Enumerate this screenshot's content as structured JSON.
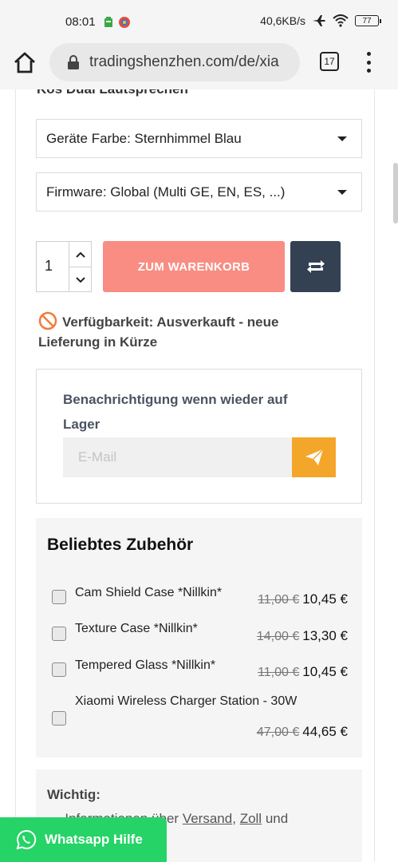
{
  "status_bar": {
    "time": "08:01",
    "speed": "40,6KB/s",
    "battery": "77",
    "icons": [
      "notification-app-icon",
      "browser-app-icon",
      "airplane-icon",
      "wifi-icon",
      "battery-icon"
    ]
  },
  "browser": {
    "url": "tradingshenzhen.com/de/xia",
    "tab_count": "17"
  },
  "product": {
    "cut_heading": "Kos Dual Lautsprechen",
    "color_select": "Geräte Farbe: Sternhimmel Blau",
    "firmware_select": "Firmware: Global (Multi GE, EN, ES, ...)",
    "quantity": "1",
    "cart_button": "ZUM WARENKORB",
    "availability": "Verfügbarkeit: Ausverkauft - neue Lieferung in Kürze"
  },
  "notify": {
    "title": "Benachrichtigung wenn wieder auf Lager",
    "email_placeholder": "E-Mail"
  },
  "accessories": {
    "title": "Beliebtes Zubehör",
    "items": [
      {
        "name": "Cam Shield Case *Nillkin*",
        "old_price": "11,00 €",
        "price": "10,45 €"
      },
      {
        "name": "Texture Case *Nillkin*",
        "old_price": "14,00 €",
        "price": "13,30 €"
      },
      {
        "name": "Tempered Glass *Nillkin*",
        "old_price": "11,00 €",
        "price": "10,45 €"
      },
      {
        "name": "Xiaomi Wireless Charger Station - 30W",
        "old_price": "47,00 €",
        "price": "44,65 €"
      }
    ]
  },
  "important": {
    "title": "Wichtig:",
    "text_prefix": "- Informationen über",
    "link_versand": "Versand",
    "separator": ",",
    "link_zoll": "Zoll",
    "text_suffix": "und"
  },
  "whatsapp": {
    "label": "Whatsapp Hilfe"
  },
  "colors": {
    "cart_button": "#f98c83",
    "compare_button": "#334152",
    "send_button": "#f4a62a",
    "whatsapp": "#25d366"
  }
}
